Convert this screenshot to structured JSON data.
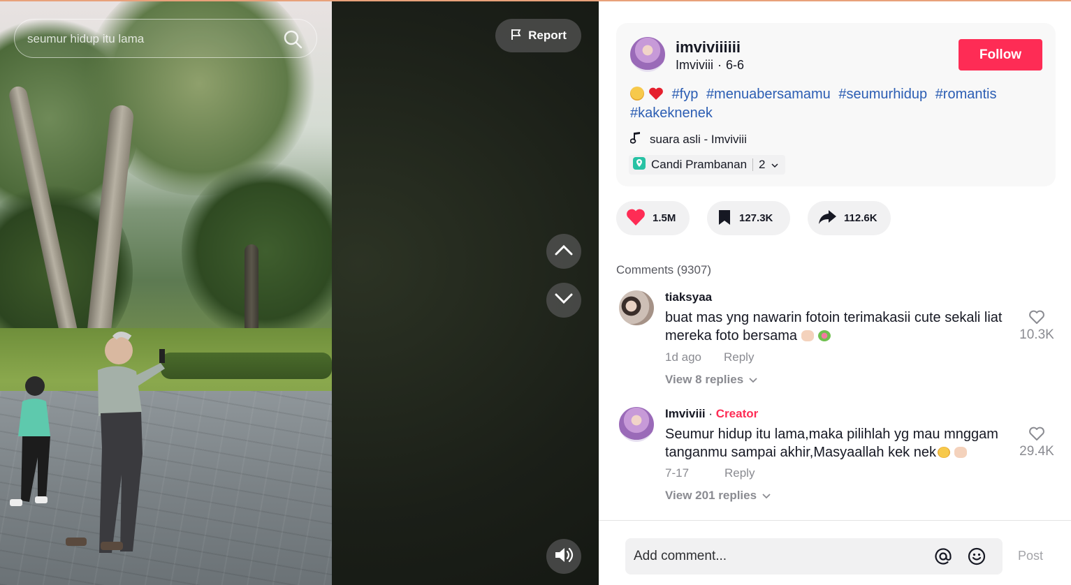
{
  "search": {
    "placeholder": "seumur hidup itu lama"
  },
  "video_controls": {
    "report_label": "Report"
  },
  "post": {
    "username": "imviviiiiii",
    "display_name": "Imviviii",
    "date": "6-6",
    "separator": "·",
    "follow_label": "Follow",
    "caption_tags": [
      "#fyp",
      "#menuabersamamu",
      "#seumurhidup",
      "#romantis",
      "#kakeknenek"
    ],
    "music": "suara asli - Imviviii",
    "location": "Candi Prambanan",
    "location_count": "2"
  },
  "stats": {
    "likes": "1.5M",
    "saves": "127.3K",
    "shares": "112.6K"
  },
  "comments_header": "Comments (9307)",
  "comments": [
    {
      "name": "tiaksyaa",
      "text": "buat mas yng nawarin fotoin terimakasii cute sekali liat mereka foto bersama",
      "time": "1d ago",
      "reply_label": "Reply",
      "likes": "10.3K",
      "view_replies": "View 8 replies"
    },
    {
      "name": "Imviviii",
      "badge_sep": "·",
      "badge": "Creator",
      "text": "Seumur hidup itu lama,maka pilihlah yg mau mnggam tanganmu sampai akhir,Masyaallah kek nek",
      "time": "7-17",
      "reply_label": "Reply",
      "likes": "29.4K",
      "view_replies": "View 201 replies"
    }
  ],
  "composer": {
    "placeholder": "Add comment...",
    "post_label": "Post"
  },
  "colors": {
    "brand_red": "#fe2c55",
    "hashtag_blue": "#2b5db3",
    "muted_text": "#8a8b91"
  },
  "icons": [
    "search-icon",
    "flag-icon",
    "chevron-up-icon",
    "chevron-down-icon",
    "volume-icon",
    "music-note-icon",
    "location-pin-icon",
    "heart-icon",
    "bookmark-icon",
    "share-icon",
    "mention-icon",
    "emoji-icon"
  ]
}
